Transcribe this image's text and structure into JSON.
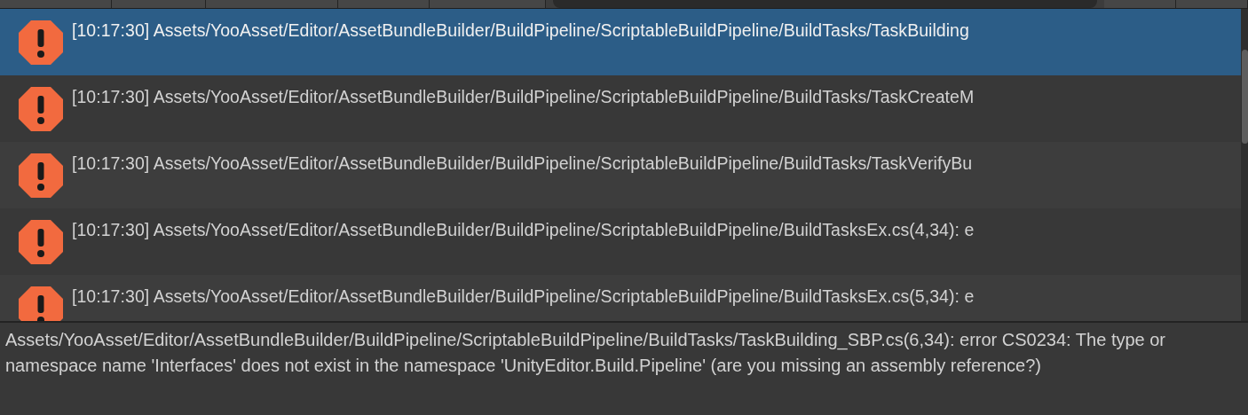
{
  "log_entries": [
    {
      "text": "[10:17:30] Assets/YooAsset/Editor/AssetBundleBuilder/BuildPipeline/ScriptableBuildPipeline/BuildTasks/TaskBuilding",
      "kind": "error",
      "selected": true
    },
    {
      "text": "[10:17:30] Assets/YooAsset/Editor/AssetBundleBuilder/BuildPipeline/ScriptableBuildPipeline/BuildTasks/TaskCreateM",
      "kind": "error",
      "selected": false
    },
    {
      "text": "[10:17:30] Assets/YooAsset/Editor/AssetBundleBuilder/BuildPipeline/ScriptableBuildPipeline/BuildTasks/TaskVerifyBu",
      "kind": "error",
      "selected": false
    },
    {
      "text": "[10:17:30] Assets/YooAsset/Editor/AssetBundleBuilder/BuildPipeline/ScriptableBuildPipeline/BuildTasksEx.cs(4,34): e",
      "kind": "error",
      "selected": false
    },
    {
      "text": "[10:17:30] Assets/YooAsset/Editor/AssetBundleBuilder/BuildPipeline/ScriptableBuildPipeline/BuildTasksEx.cs(5,34): e",
      "kind": "error",
      "selected": false
    }
  ],
  "detail": "Assets/YooAsset/Editor/AssetBundleBuilder/BuildPipeline/ScriptableBuildPipeline/BuildTasks/TaskBuilding_SBP.cs(6,34): error CS0234: The type or namespace name 'Interfaces' does not exist in the namespace 'UnityEditor.Build.Pipeline' (are you missing an assembly reference?)"
}
